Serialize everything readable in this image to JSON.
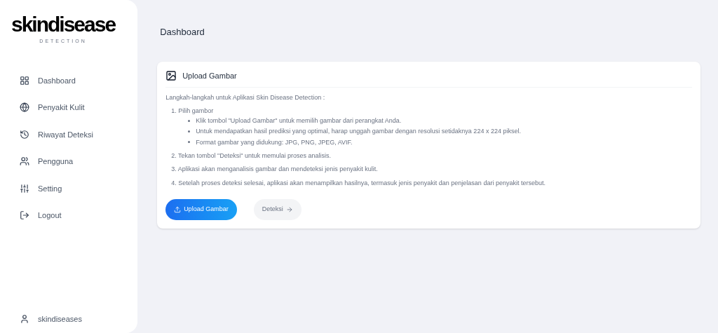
{
  "logo": {
    "title": "skindisease",
    "subtitle": "DETECTION"
  },
  "sidebar": {
    "items": [
      {
        "kind": "dashboard",
        "label": "Dashboard",
        "selected": false
      },
      {
        "kind": "disease",
        "label": "Penyakit Kulit",
        "selected": false
      },
      {
        "kind": "history",
        "label": "Riwayat Deteksi",
        "selected": false
      },
      {
        "kind": "users",
        "label": "Pengguna",
        "selected": false
      },
      {
        "kind": "settings",
        "label": "Setting",
        "selected": false
      },
      {
        "kind": "logout",
        "label": "Logout",
        "selected": false
      }
    ],
    "user": "skindiseases"
  },
  "header": {
    "title": "Dashboard"
  },
  "card": {
    "title": "Upload Gambar",
    "intro": "Langkah-langkah untuk Aplikasi Skin Disease Detection :",
    "steps": [
      {
        "text": "1. Pilih gambor",
        "bullets": [
          "Klik tombol \"Upload Gambar\" untuk memilih gambar dari perangkat Anda.",
          "Untuk mendapatkan hasil prediksi yang optimal, harap unggah gambar dengan resolusi setidaknya 224 x 224 piksel.",
          "Format gambar yang didukung: JPG, PNG, JPEG, AVIF."
        ]
      },
      {
        "text": "2. Tekan tombol \"Deteksi\" untuk memulai proses analisis."
      },
      {
        "text": "3. Aplikasi akan menganalisis gambar dan mendeteksi jenis penyakit kulit."
      },
      {
        "text": "4. Setelah proses deteksi selesai, aplikasi akan menampilkan hasilnya, termasuk jenis penyakit dan penjelasan dari penyakit tersebut."
      }
    ],
    "buttons": [
      {
        "kind": "upload",
        "label": "Upload Gambar",
        "disabled": false
      },
      {
        "kind": "detect",
        "label": "Deteksi",
        "disabled": true
      }
    ]
  }
}
